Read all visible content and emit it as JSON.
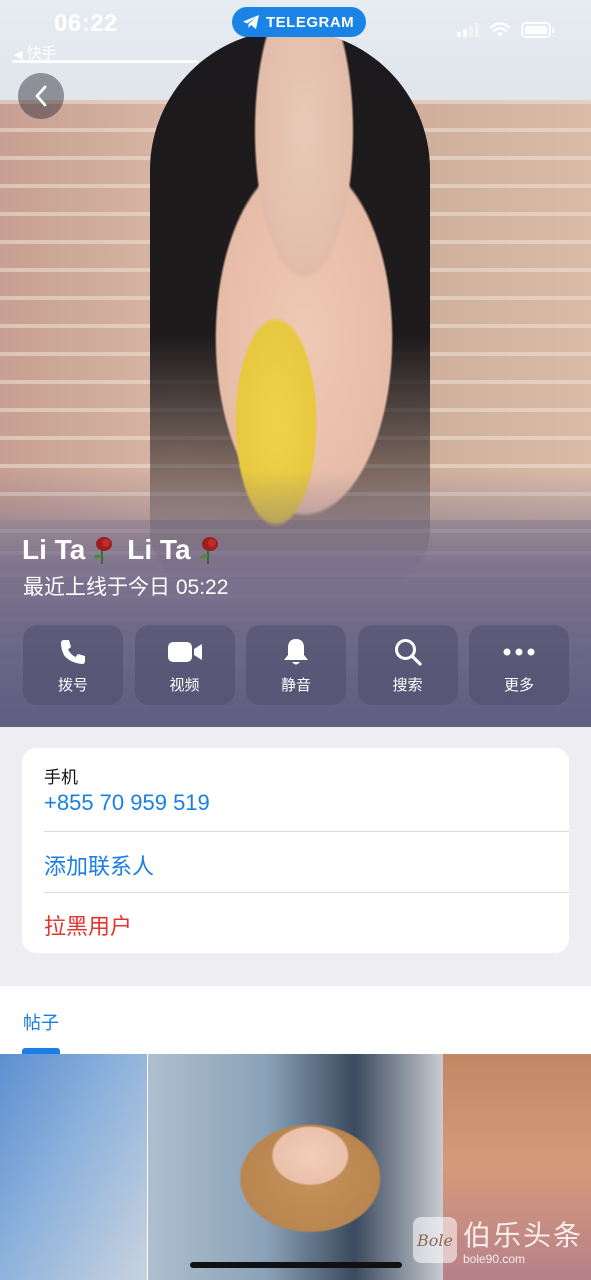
{
  "status_bar": {
    "time": "06:22",
    "back_app": "快手",
    "pill_label": "TELEGRAM",
    "icons": [
      "signal-icon",
      "wifi-icon",
      "battery-icon"
    ]
  },
  "profile": {
    "name": "Li Ta🥀 Li Ta 🥀",
    "name_part1": "Li Ta",
    "name_part2": "Li Ta",
    "last_seen": "最近上线于今日 05:22"
  },
  "actions": [
    {
      "label": "拨号",
      "icon": "phone-icon"
    },
    {
      "label": "视频",
      "icon": "video-icon"
    },
    {
      "label": "静音",
      "icon": "bell-icon"
    },
    {
      "label": "搜索",
      "icon": "search-icon"
    },
    {
      "label": "更多",
      "icon": "more-icon"
    }
  ],
  "info": {
    "phone_title": "手机",
    "phone_number": "+855 70 959 519",
    "add_contact": "添加联系人",
    "block_user": "拉黑用户"
  },
  "posts": {
    "tab_label": "帖子"
  },
  "watermark": {
    "logo_text": "Bole",
    "cn": "伯乐头条",
    "url": "bole90.com"
  },
  "colors": {
    "accent": "#1b7ee6",
    "danger": "#e5342f",
    "pill": "#1a84e6"
  }
}
